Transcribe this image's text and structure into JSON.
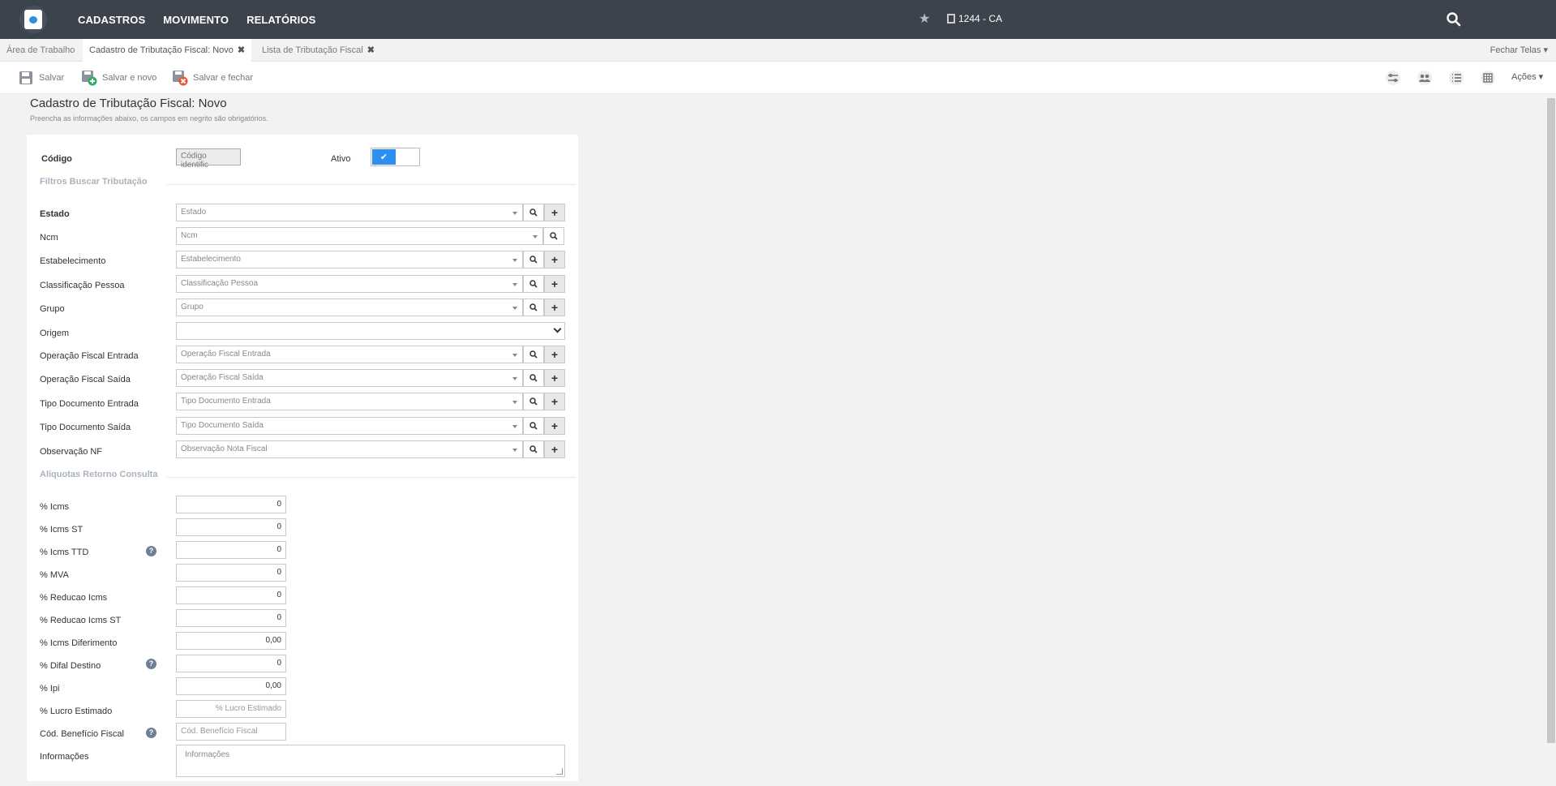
{
  "nav": {
    "items": [
      "CADASTROS",
      "MOVIMENTO",
      "RELATÓRIOS"
    ],
    "company": "1244 - CA"
  },
  "tabs": {
    "items": [
      "Área de Trabalho",
      "Cadastro de Tributação Fiscal: Novo",
      "Lista de Tributação Fiscal"
    ],
    "close_glyph": "✖",
    "close_all": "Fechar Telas"
  },
  "toolbar": {
    "save": "Salvar",
    "save_new": "Salvar e novo",
    "save_close": "Salvar e fechar",
    "actions": "Ações"
  },
  "page": {
    "title": "Cadastro de Tributação Fiscal: Novo",
    "subtitle": "Preencha as informações abaixo, os campos em negrito são obrigatórios."
  },
  "form": {
    "codigo_label": "Código",
    "codigo_button": "Código identific",
    "ativo_label": "Ativo",
    "section_filters": "Filtros Buscar Tributação",
    "section_rates": "Alíquotas Retorno Consulta",
    "filters": [
      {
        "label": "Estado",
        "placeholder": "Estado"
      },
      {
        "label": "Ncm",
        "placeholder": "Ncm"
      },
      {
        "label": "Estabelecimento",
        "placeholder": "Estabelecimento"
      },
      {
        "label": "Classificação Pessoa",
        "placeholder": "Classificação Pessoa"
      },
      {
        "label": "Grupo",
        "placeholder": "Grupo"
      },
      {
        "label": "Origem",
        "placeholder": ""
      },
      {
        "label": "Operação Fiscal Entrada",
        "placeholder": "Operação Fiscal Entrada"
      },
      {
        "label": "Operação Fiscal Saída",
        "placeholder": "Operação Fiscal Saída"
      },
      {
        "label": "Tipo Documento Entrada",
        "placeholder": "Tipo Documento Entrada"
      },
      {
        "label": "Tipo Documento Saída",
        "placeholder": "Tipo Documento Saída"
      },
      {
        "label": "Observação NF",
        "placeholder": "Observação Nota Fiscal"
      }
    ],
    "rates": [
      {
        "label": "% Icms",
        "value": "0"
      },
      {
        "label": "% Icms ST",
        "value": "0"
      },
      {
        "label": "% Icms TTD",
        "value": "0"
      },
      {
        "label": "% MVA",
        "value": "0"
      },
      {
        "label": "% Reducao Icms",
        "value": "0"
      },
      {
        "label": "% Reducao Icms ST",
        "value": "0"
      },
      {
        "label": "% Icms Diferimento",
        "value": "0,00"
      },
      {
        "label": "% Difal Destino",
        "value": "0"
      },
      {
        "label": "% Ipi",
        "value": "0,00"
      },
      {
        "label": "% Lucro Estimado",
        "value": "% Lucro Estimado"
      },
      {
        "label": "Cód. Benefício Fiscal",
        "value": "Cód. Benefício Fiscal"
      },
      {
        "label": "Informações",
        "value": "Informações"
      }
    ],
    "help_glyph": "?"
  }
}
